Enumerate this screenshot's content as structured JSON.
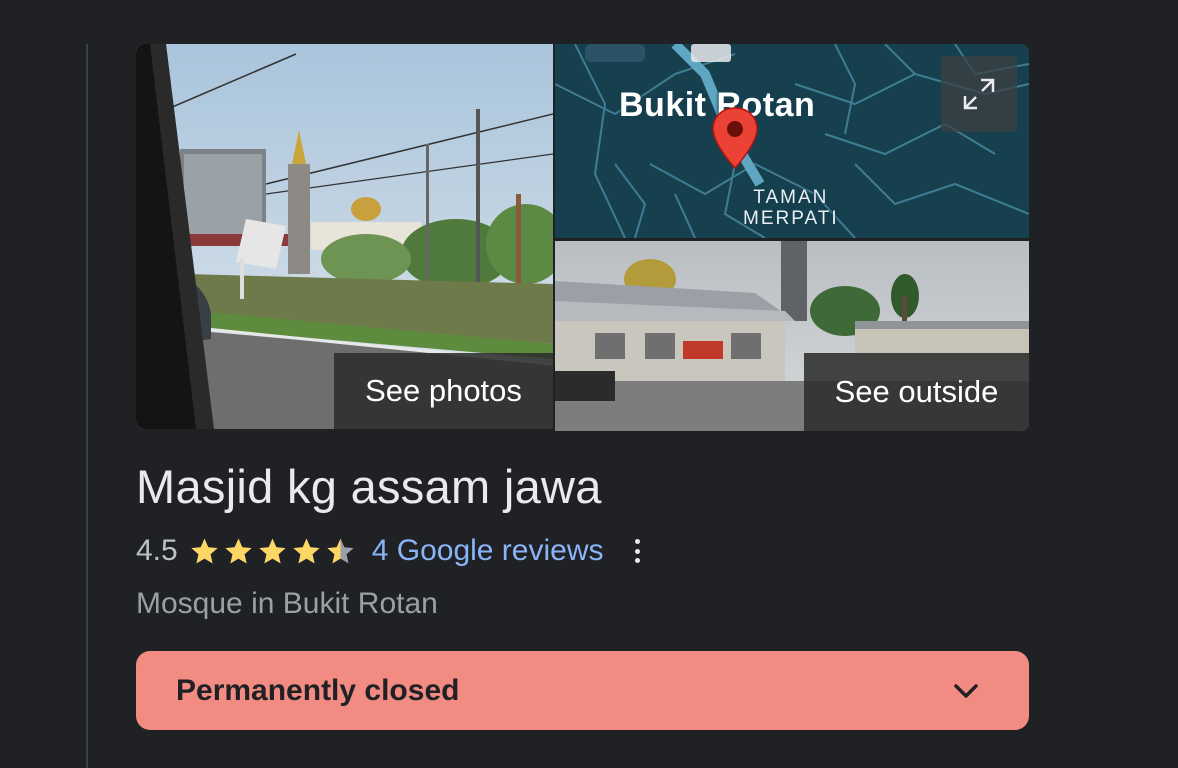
{
  "media": {
    "see_photos_label": "See photos",
    "see_outside_label": "See outside",
    "map": {
      "place_label": "Bukit Rotan",
      "area_label_line1": "TAMAN",
      "area_label_line2": "MERPATI",
      "pin_icon": "map-pin-icon",
      "expand_icon": "expand-icon"
    }
  },
  "place": {
    "title": "Masjid kg assam jawa",
    "rating": "4.5",
    "stars_filled": 4.5,
    "stars_total": 5,
    "reviews_label": "4 Google reviews",
    "category": "Mosque in Bukit Rotan"
  },
  "status": {
    "label": "Permanently closed",
    "icon": "chevron-down-icon"
  },
  "colors": {
    "background": "#202124",
    "title": "#e8eaed",
    "link": "#8ab4f8",
    "star": "#fdd663",
    "status_bg": "#f28b82",
    "map_bg": "#17404f",
    "pin": "#ea4335"
  }
}
